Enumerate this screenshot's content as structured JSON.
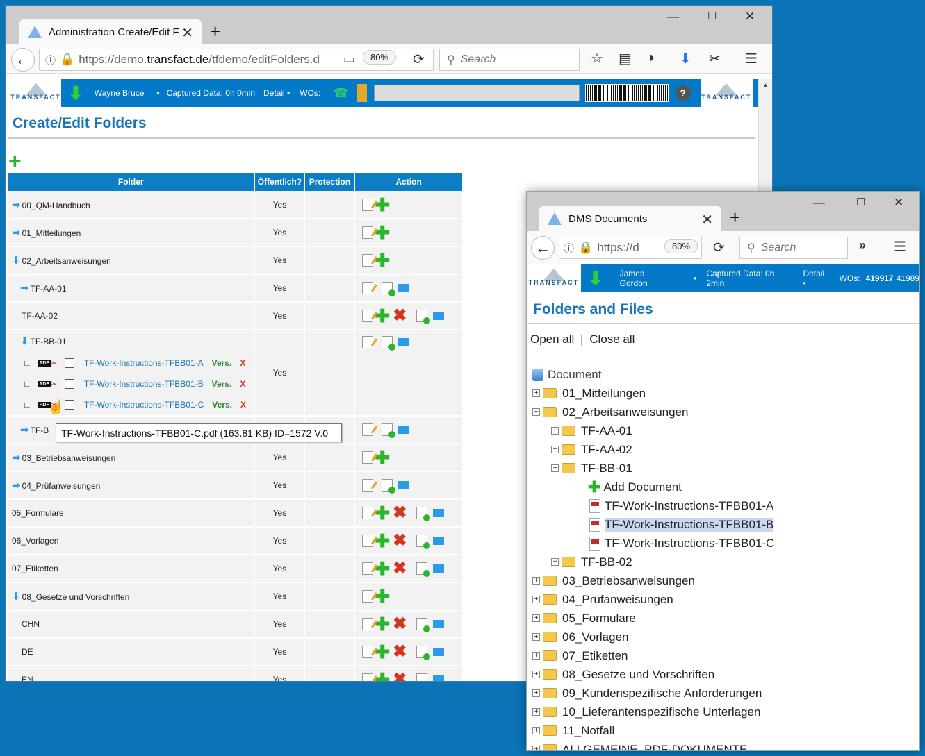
{
  "w1": {
    "tab_title": "Administration Create/Edit F",
    "url_prefix": "https://demo.",
    "url_domain": "transfact.de",
    "url_suffix": "/tfdemo/editFolders.d",
    "zoom": "80%",
    "search": "Search",
    "app": {
      "user": "Wayne Bruce",
      "captured": "Captured Data: 0h 0min",
      "detail": "Detail •",
      "wos": "WOs:",
      "logo": "TRANSFACT",
      "help": "?"
    },
    "page_title": "Create/Edit Folders",
    "headers": [
      "Folder",
      "Öffentlich?",
      "Protection",
      "Action"
    ],
    "rows": [
      {
        "name": "00_QM-Handbuch",
        "pub": "Yes"
      },
      {
        "name": "01_Mitteilungen",
        "pub": "Yes"
      },
      {
        "name": "02_Arbeitsanweisungen",
        "pub": "Yes"
      },
      {
        "name": "TF-AA-01",
        "pub": "Yes"
      },
      {
        "name": "TF-AA-02",
        "pub": "Yes"
      },
      {
        "name": "TF-BB-01",
        "pub": "Yes"
      },
      {
        "name": "TF-B",
        "pub": ""
      },
      {
        "name": "03_Betriebsanweisungen",
        "pub": "Yes"
      },
      {
        "name": "04_Prüfanweisungen",
        "pub": "Yes"
      },
      {
        "name": "05_Formulare",
        "pub": "Yes"
      },
      {
        "name": "06_Vorlagen",
        "pub": "Yes"
      },
      {
        "name": "07_Etiketten",
        "pub": "Yes"
      },
      {
        "name": "08_Gesetze und Vorschriften",
        "pub": "Yes"
      },
      {
        "name": "CHN",
        "pub": "Yes"
      },
      {
        "name": "DE",
        "pub": "Yes"
      },
      {
        "name": "EN",
        "pub": "Yes"
      }
    ],
    "docs": [
      "TF-Work-Instructions-TFBB01-A",
      "TF-Work-Instructions-TFBB01-B",
      "TF-Work-Instructions-TFBB01-C"
    ],
    "vers": "Vers.",
    "x": "X",
    "pdf": "PDF",
    "tooltip": "TF-Work-Instructions-TFBB01-C.pdf (163.81 KB) ID=1572 V.0"
  },
  "w2": {
    "tab_title": "DMS Documents",
    "url": "https://d",
    "zoom": "80%",
    "search": "Search",
    "app": {
      "user": "James Gordon",
      "captured": "Captured Data: 0h 2min",
      "detail": "Detail •",
      "wos": "WOs:",
      "wo1": "419917",
      "wo2": "41989",
      "logo": "TRANSFACT"
    },
    "page_title": "Folders and Files",
    "open_all": "Open all",
    "sep": "|",
    "close_all": "Close all",
    "root": "Document",
    "tree": [
      {
        "l": "01_Mitteilungen"
      },
      {
        "l": "02_Arbeitsanweisungen"
      },
      {
        "l": "TF-AA-01"
      },
      {
        "l": "TF-AA-02"
      },
      {
        "l": "TF-BB-01"
      },
      {
        "l": "Add Document"
      },
      {
        "l": "TF-Work-Instructions-TFBB01-A"
      },
      {
        "l": "TF-Work-Instructions-TFBB01-B"
      },
      {
        "l": "TF-Work-Instructions-TFBB01-C"
      },
      {
        "l": "TF-BB-02"
      },
      {
        "l": "03_Betriebsanweisungen"
      },
      {
        "l": "04_Prüfanweisungen"
      },
      {
        "l": "05_Formulare"
      },
      {
        "l": "06_Vorlagen"
      },
      {
        "l": "07_Etiketten"
      },
      {
        "l": "08_Gesetze und Vorschriften"
      },
      {
        "l": "09_Kundenspezifische Anforderungen"
      },
      {
        "l": "10_Lieferantenspezifische Unterlagen"
      },
      {
        "l": "11_Notfall"
      },
      {
        "l": "ALLGEMEINE_PDF-DOKUMENTE"
      }
    ]
  }
}
